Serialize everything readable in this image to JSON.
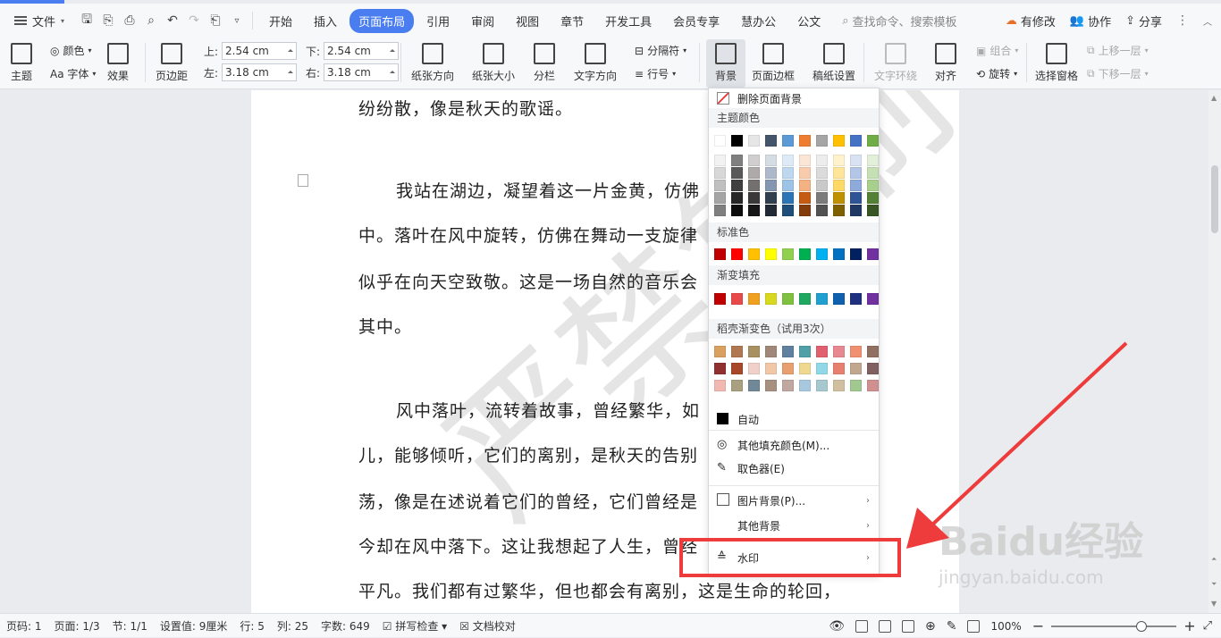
{
  "menubar": {
    "file": "文件",
    "tabs": [
      "开始",
      "插入",
      "页面布局",
      "引用",
      "审阅",
      "视图",
      "章节",
      "开发工具",
      "会员专享",
      "慧办公",
      "公文"
    ],
    "active_tab": "页面布局",
    "search": "查找命令、搜索模板",
    "actions": [
      "有修改",
      "协作",
      "分享"
    ]
  },
  "ribbon": {
    "theme": "主题",
    "colors": "颜色",
    "font": "Aa 字体",
    "effects": "效果",
    "margins": "页边距",
    "top_label": "上:",
    "top_value": "2.54 cm",
    "bottom_label": "下:",
    "bottom_value": "2.54 cm",
    "left_label": "左:",
    "left_value": "3.18 cm",
    "right_label": "右:",
    "right_value": "3.18 cm",
    "orientation": "纸张方向",
    "size": "纸张大小",
    "columns": "分栏",
    "text_direction": "文字方向",
    "separator": "分隔符",
    "line_number": "行号",
    "background": "背景",
    "border": "页面边框",
    "grid_paper": "稿纸设置",
    "wrap": "文字环绕",
    "align": "对齐",
    "group": "组合",
    "rotate": "旋转",
    "selection": "选择窗格",
    "bring_forward": "上移一层",
    "send_backward": "下移一层"
  },
  "document": {
    "lines": [
      "纷纷散，像是秋天的歌谣。",
      "我站在湖边，凝望着这一片金黄，仿佛",
      "中。落叶在风中旋转，仿佛在舞动一支旋律",
      "似乎在向天空致敬。这是一场自然的音乐会",
      "其中。",
      "风中落叶，流转着故事，曾经繁华，如",
      "儿，能够倾听，它们的离别，是秋天的告别",
      "荡，像是在述说着它们的曾经，它们曾经是",
      "今却在风中落下。这让我想起了人生，曾经",
      "平凡。我们都有过繁华，但也都会有离别，这是生命的轮回，"
    ],
    "watermark": "严禁复制"
  },
  "dropdown": {
    "remove_bg": "删除页面背景",
    "theme_colors": "主题颜色",
    "standard_colors": "标准色",
    "gradient_fill": "渐变填充",
    "shell_gradient": "稻壳渐变色（试用3次）",
    "auto": "自动",
    "more_fill": "其他填充颜色(M)...",
    "eyedropper": "取色器(E)",
    "picture_bg": "图片背景(P)...",
    "other_bg": "其他背景",
    "watermark": "水印",
    "theme_top": [
      "#ffffff",
      "#000000",
      "#e7e6e6",
      "#44546a",
      "#5b9bd5",
      "#ed7d31",
      "#a5a5a5",
      "#ffc000",
      "#4472c4",
      "#70ad47"
    ],
    "theme_shades": [
      [
        "#f2f2f2",
        "#7f7f7f",
        "#d0cece",
        "#d6dce4",
        "#deebf6",
        "#fbe5d5",
        "#ededed",
        "#fff2cc",
        "#d9e2f3",
        "#e2efd9"
      ],
      [
        "#d8d8d8",
        "#595959",
        "#aeaaaa",
        "#adb9ca",
        "#bdd7ee",
        "#f7cbac",
        "#dbdbdb",
        "#fee599",
        "#b4c6e7",
        "#c5e0b3"
      ],
      [
        "#bfbfbf",
        "#3f3f3f",
        "#757070",
        "#8496b0",
        "#9dc3e6",
        "#f4b183",
        "#c9c9c9",
        "#ffd965",
        "#8eaadb",
        "#a8d08d"
      ],
      [
        "#a5a5a5",
        "#262626",
        "#3a3838",
        "#323f4f",
        "#2e75b5",
        "#c55a11",
        "#7b7b7b",
        "#bf9000",
        "#2f5496",
        "#538135"
      ],
      [
        "#7f7f7f",
        "#0c0c0c",
        "#171616",
        "#222a35",
        "#1e4e79",
        "#833c0b",
        "#525252",
        "#7f6000",
        "#1f3864",
        "#375623"
      ]
    ],
    "standard": [
      "#c00000",
      "#ff0000",
      "#ffc000",
      "#ffff00",
      "#92d050",
      "#00b050",
      "#00b0f0",
      "#0070c0",
      "#002060",
      "#7030a0"
    ],
    "gradients": [
      "#c00000",
      "#e84a4a",
      "#f0a020",
      "#d8d820",
      "#80c040",
      "#20a860",
      "#20a0d0",
      "#1060b0",
      "#203080",
      "#7030a0"
    ],
    "shell": [
      [
        "#d9a060",
        "#b07850",
        "#a89060",
        "#a08878",
        "#6080a0",
        "#50a0a8",
        "#e06070",
        "#e88890",
        "#f09070",
        "#907060"
      ],
      [
        "#903030",
        "#a84828",
        "#f0d0c8",
        "#f0c8a8",
        "#e8a070",
        "#f0d890",
        "#90d8e8",
        "#e88070",
        "#c0a890",
        "#806060"
      ],
      [
        "#f0b8b0",
        "#a8a080",
        "#708898",
        "#a89080",
        "#c0a8a0",
        "#a8c8e0",
        "#a8c8d0",
        "#d0c0a0",
        "#a0c890",
        "#d09090"
      ]
    ]
  },
  "status": {
    "page_num": "页码: 1",
    "page": "页面: 1/3",
    "section": "节: 1/1",
    "setting": "设置值: 9厘米",
    "row": "行: 5",
    "col": "列: 25",
    "words": "字数: 649",
    "spell": "拼写检查",
    "doc_check": "文档校对",
    "zoom": "100%",
    "zoom_level": 0.72
  },
  "branding": {
    "baidu": "Baidu经验",
    "baidu_url": "jingyan.baidu.com"
  }
}
